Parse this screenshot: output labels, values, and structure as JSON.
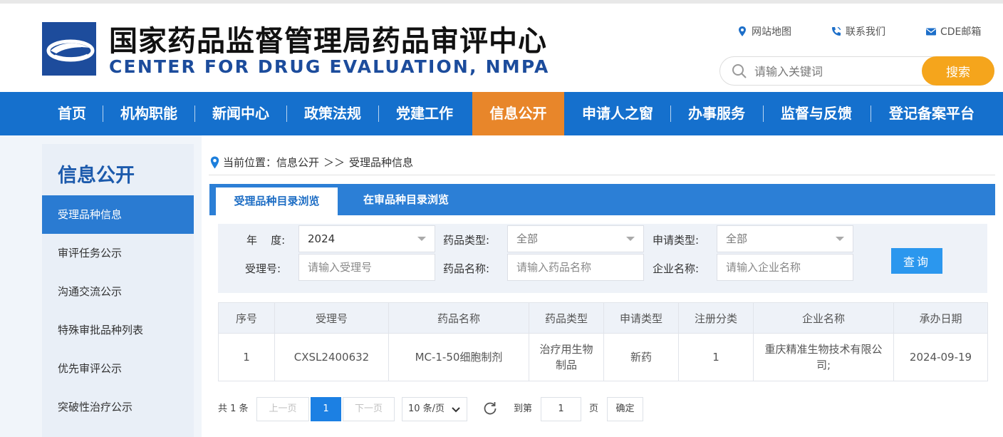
{
  "header": {
    "title_cn": "国家药品监督管理局药品审评中心",
    "title_en": "CENTER FOR DRUG EVALUATION, NMPA",
    "links": [
      {
        "label": "网站地图",
        "icon": "location-pin-icon"
      },
      {
        "label": "联系我们",
        "icon": "phone-icon"
      },
      {
        "label": "CDE邮箱",
        "icon": "mail-icon"
      }
    ],
    "search": {
      "placeholder": "请输入关键词",
      "button": "搜索"
    }
  },
  "colors": {
    "brand_blue": "#1570cd",
    "accent_orange": "#e8862a",
    "search_button": "#f5a51c",
    "query_button": "#2b97ee"
  },
  "nav": {
    "items": [
      "首页",
      "机构职能",
      "新闻中心",
      "政策法规",
      "党建工作",
      "信息公开",
      "申请人之窗",
      "办事服务",
      "监督与反馈",
      "登记备案平台"
    ],
    "active": "信息公开"
  },
  "sidebar": {
    "title": "信息公开",
    "items": [
      "受理品种信息",
      "审评任务公示",
      "沟通交流公示",
      "特殊审批品种列表",
      "优先审评公示",
      "突破性治疗公示"
    ],
    "active": "受理品种信息"
  },
  "breadcrumb": {
    "prefix": "当前位置：",
    "parent": "信息公开",
    "sep": "＞＞",
    "current": "受理品种信息"
  },
  "tabs": [
    "受理品种目录浏览",
    "在审品种目录浏览"
  ],
  "filter": {
    "year_label": "年    度:",
    "year_value": "2024",
    "drug_type_label": "药品类型:",
    "drug_type_value": "全部",
    "apply_type_label": "申请类型:",
    "apply_type_value": "全部",
    "accept_no_label": "受理号:",
    "accept_no_placeholder": "请输入受理号",
    "drug_name_label": "药品名称:",
    "drug_name_placeholder": "请输入药品名称",
    "company_label": "企业名称:",
    "company_placeholder": "请输入企业名称",
    "query_button": "查询"
  },
  "table": {
    "columns": [
      "序号",
      "受理号",
      "药品名称",
      "药品类型",
      "申请类型",
      "注册分类",
      "企业名称",
      "承办日期"
    ],
    "rows": [
      [
        "1",
        "CXSL2400632",
        "MC-1-50细胞制剂",
        "治疗用生物制品",
        "新药",
        "1",
        "重庆精准生物技术有限公司;",
        "2024-09-19"
      ]
    ]
  },
  "pagination": {
    "total": "共 1 条",
    "prev": "上一页",
    "current": "1",
    "next": "下一页",
    "page_size": "10 条/页",
    "goto_label": "到第",
    "goto_value": "1",
    "page_unit": "页",
    "confirm": "确定"
  }
}
